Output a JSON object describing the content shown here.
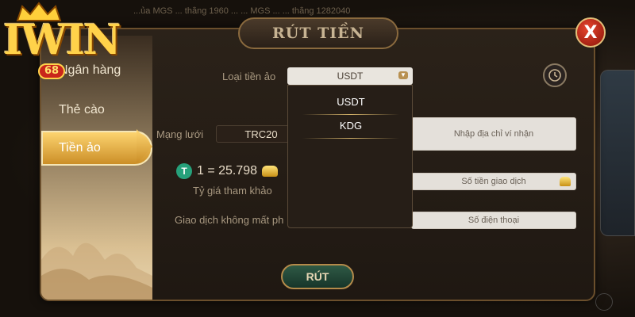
{
  "background": {
    "ticker": "...ủa MGS ... thắng 1960 ... ... MGS ... ... thắng 1282040"
  },
  "logo": {
    "brand": "IWIN",
    "num": "68"
  },
  "dialog": {
    "title": "RÚT TIỀN",
    "close": "X"
  },
  "sidebar": {
    "tabs": [
      "Ngân hàng",
      "Thẻ cào",
      "Tiền ảo"
    ],
    "active": "Tiền ảo"
  },
  "form": {
    "currency_label": "Loại tiền ảo",
    "currency_value": "USDT",
    "network_label": "Mạng lưới",
    "network_value": "TRC20",
    "address_placeholder": "Nhập địa chỉ ví nhận",
    "rate_text": "1 = 25.798",
    "rate_caption": "Tỷ giá tham khảo",
    "amount_placeholder": "Số tiền giao dịch",
    "no_loss_label": "Giao dịch không mất ph",
    "phone_placeholder": "Số điện thoại",
    "submit": "RÚT"
  },
  "dropdown": {
    "options": [
      "USDT",
      "KDG"
    ]
  },
  "colors": {
    "accent_gold": "#d4b36a",
    "tab_active": "#e7a83a",
    "close_red": "#c2281a",
    "submit_green": "#24473a",
    "tether_green": "#26a17b"
  },
  "icons": {
    "close": "close-icon",
    "history": "history-icon",
    "dropdown": "chevron-down-icon",
    "currency": "tether-icon",
    "gold": "gold-ingot-icon"
  }
}
